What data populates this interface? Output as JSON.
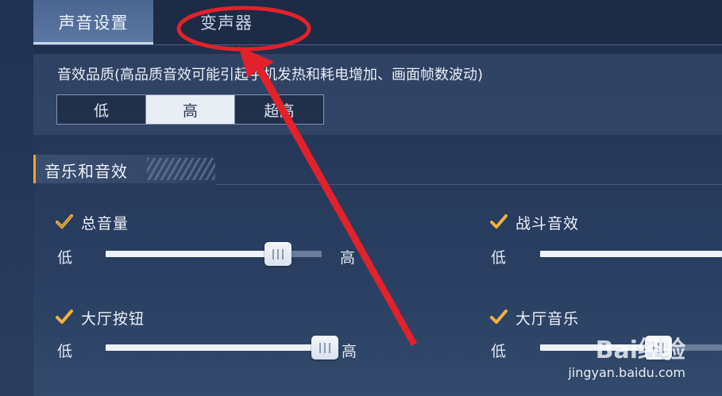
{
  "tabs": [
    {
      "label": "声音设置",
      "active": true
    },
    {
      "label": "变声器",
      "active": false
    }
  ],
  "quality": {
    "label": "音效品质(高品质音效可能引起手机发热和耗电增加、画面帧数波动)",
    "options": [
      "低",
      "高",
      "超高"
    ],
    "selected": "高"
  },
  "section": {
    "title": "音乐和音效"
  },
  "sliders": {
    "master": {
      "label": "总音量",
      "low": "低",
      "high": "高",
      "value": 0.76,
      "checked": true
    },
    "combat": {
      "label": "战斗音效",
      "low": "低",
      "checked": true
    },
    "lobby_button": {
      "label": "大厅按钮",
      "low": "低",
      "high": "高",
      "value": 1.0,
      "checked": true
    },
    "lobby_music": {
      "label": "大厅音乐",
      "low": "低",
      "checked": true
    }
  },
  "watermark": {
    "logo": "Bai经验",
    "url": "jingyan.baidu.com"
  },
  "colors": {
    "accent": "#f0a62a",
    "annotation": "#e3212a"
  }
}
